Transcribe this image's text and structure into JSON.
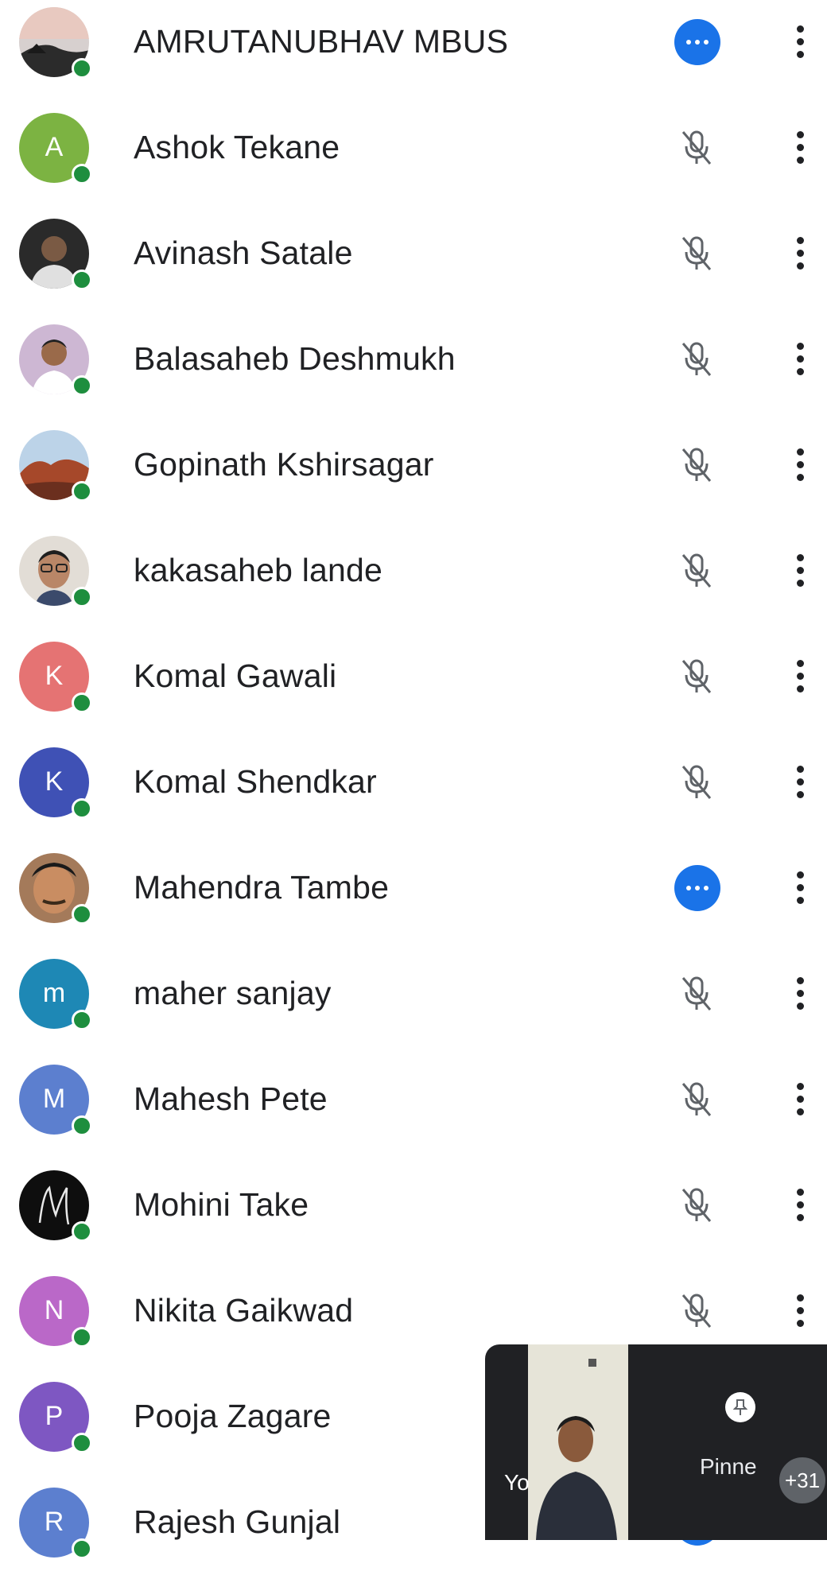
{
  "participants": [
    {
      "name": "AMRUTANUBHAV MBUS",
      "initial": "",
      "avatar_color": "#6b6b6b",
      "photo": "sunset",
      "status": "speaking"
    },
    {
      "name": "Ashok Tekane",
      "initial": "A",
      "avatar_color": "#7cb342",
      "photo": "",
      "status": "muted"
    },
    {
      "name": "Avinash Satale",
      "initial": "",
      "avatar_color": "#3c3c3c",
      "photo": "person-dark",
      "status": "muted"
    },
    {
      "name": "Balasaheb Deshmukh",
      "initial": "",
      "avatar_color": "#c9a7c7",
      "photo": "person-light",
      "status": "muted"
    },
    {
      "name": "Gopinath Kshirsagar",
      "initial": "",
      "avatar_color": "#a9542e",
      "photo": "landscape",
      "status": "muted"
    },
    {
      "name": "kakasaheb lande",
      "initial": "",
      "avatar_color": "#d9d4cc",
      "photo": "person-glasses",
      "status": "muted"
    },
    {
      "name": "Komal Gawali",
      "initial": "K",
      "avatar_color": "#e57373",
      "photo": "",
      "status": "muted"
    },
    {
      "name": "Komal Shendkar",
      "initial": "K",
      "avatar_color": "#3f51b5",
      "photo": "",
      "status": "muted"
    },
    {
      "name": "Mahendra Tambe",
      "initial": "",
      "avatar_color": "#8d6e63",
      "photo": "person-face",
      "status": "speaking"
    },
    {
      "name": "maher sanjay",
      "initial": "m",
      "avatar_color": "#1e88b5",
      "photo": "",
      "status": "muted"
    },
    {
      "name": "Mahesh Pete",
      "initial": "M",
      "avatar_color": "#5c7fcf",
      "photo": "",
      "status": "muted"
    },
    {
      "name": "Mohini Take",
      "initial": "",
      "avatar_color": "#111111",
      "photo": "monogram",
      "status": "muted"
    },
    {
      "name": "Nikita Gaikwad",
      "initial": "N",
      "avatar_color": "#ba68c8",
      "photo": "",
      "status": "muted"
    },
    {
      "name": "Pooja Zagare",
      "initial": "P",
      "avatar_color": "#7e57c2",
      "photo": "",
      "status": "none"
    },
    {
      "name": "Rajesh Gunjal",
      "initial": "R",
      "avatar_color": "#5c7fcf",
      "photo": "",
      "status": "speaking"
    }
  ],
  "pip": {
    "self_label": "Yo",
    "pinned_label": "Pinne",
    "others_count": "+31"
  },
  "colors": {
    "online": "#1e8e3e",
    "speaking": "#1a73e8",
    "text": "#202124",
    "muted_icon": "#5f6368"
  }
}
